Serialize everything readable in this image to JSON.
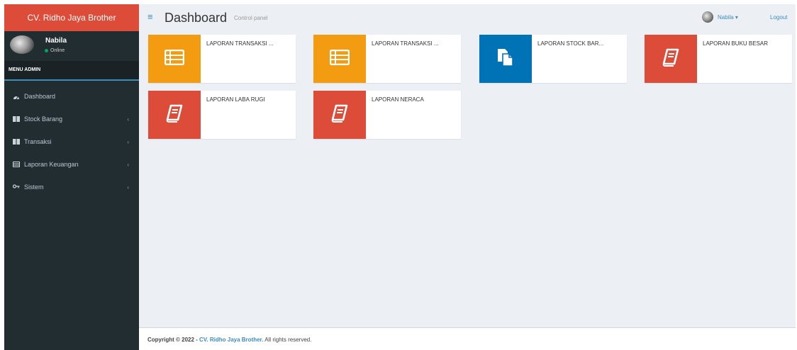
{
  "sidebar": {
    "brand": "CV. Ridho Jaya Brother",
    "user_name": "Nabila",
    "user_status": "Online",
    "menu_header": "MENU ADMIN",
    "items": [
      {
        "label": "Dashboard",
        "icon": "dashboard-icon",
        "has_chevron": false
      },
      {
        "label": "Stock Barang",
        "icon": "book-icon",
        "has_chevron": true
      },
      {
        "label": "Transaksi",
        "icon": "book-icon",
        "has_chevron": true
      },
      {
        "label": "Laporan Keuangan",
        "icon": "list-icon",
        "has_chevron": true
      },
      {
        "label": "Sistem",
        "icon": "key-icon",
        "has_chevron": true
      }
    ]
  },
  "header": {
    "title": "Dashboard",
    "subtitle": "Control panel",
    "user_menu": "Nabila ▾",
    "logout": "Logout"
  },
  "boxes": [
    {
      "label": "LAPORAN TRANSAKSI ...",
      "color": "#f39c12",
      "icon": "list-icon"
    },
    {
      "label": "LAPORAN TRANSAKSI ...",
      "color": "#f39c12",
      "icon": "list-icon"
    },
    {
      "label": "LAPORAN STOCK BAR...",
      "color": "#0073b7",
      "icon": "copy-icon"
    },
    {
      "label": "LAPORAN BUKU BESAR",
      "color": "#dd4b39",
      "icon": "book-icon"
    },
    {
      "label": "LAPORAN LABA RUGI",
      "color": "#dd4b39",
      "icon": "book-icon"
    },
    {
      "label": "LAPORAN NERACA",
      "color": "#dd4b39",
      "icon": "book-icon"
    }
  ],
  "footer": {
    "prefix": "Copyright © 2022 - ",
    "company": "CV. Ridho Jaya Brother.",
    "suffix": " All rights reserved."
  },
  "colors": {
    "brand": "#dd4b39",
    "sidebar": "#222d32",
    "accent": "#3c8dbc",
    "yellow": "#f39c12",
    "blue": "#0073b7",
    "red": "#dd4b39"
  }
}
